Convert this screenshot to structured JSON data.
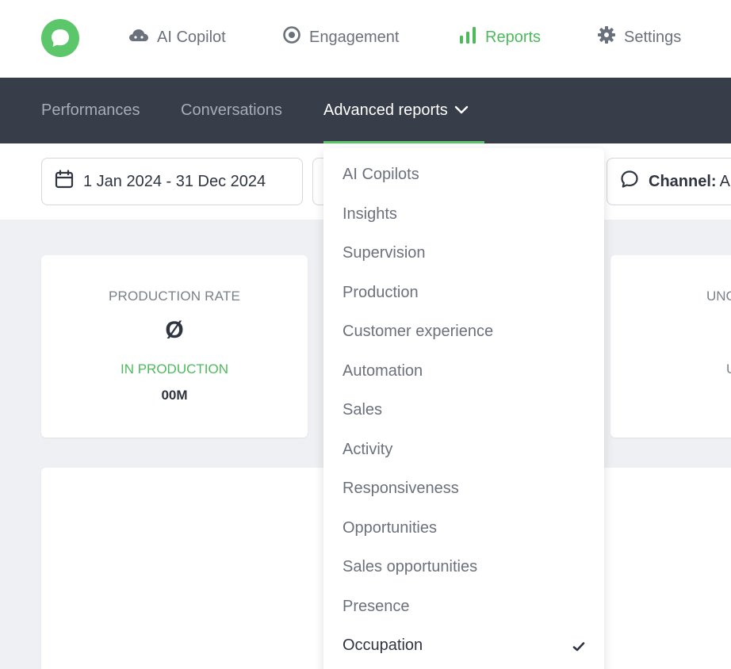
{
  "topnav": {
    "items": [
      {
        "label": "AI Copilot",
        "icon": "cloud-icon"
      },
      {
        "label": "Engagement",
        "icon": "target-icon"
      },
      {
        "label": "Reports",
        "icon": "bar-chart-icon",
        "active": true
      },
      {
        "label": "Settings",
        "icon": "gear-icon"
      }
    ]
  },
  "subnav": {
    "items": [
      {
        "label": "Performances"
      },
      {
        "label": "Conversations"
      },
      {
        "label": "Advanced reports",
        "active": true
      }
    ]
  },
  "filters": {
    "date_range": "1 Jan 2024 - 31 Dec 2024",
    "channel_label": "Channel:",
    "channel_value": "A"
  },
  "card": {
    "label": "PRODUCTION RATE",
    "value_symbol": "Ø",
    "sub_label": "IN PRODUCTION",
    "sub_value": "00M",
    "right_label_clip": "UNC",
    "right_sub_clip": "U"
  },
  "dropdown": {
    "items": [
      "AI Copilots",
      "Insights",
      "Supervision",
      "Production",
      "Customer experience",
      "Automation",
      "Sales",
      "Activity",
      "Responsiveness",
      "Opportunities",
      "Sales opportunities",
      "Presence",
      "Occupation"
    ],
    "selected": "Occupation"
  },
  "colors": {
    "accent_green": "#5cc66b",
    "subnav_bg": "#373d49",
    "page_bg": "#eef0f4"
  }
}
